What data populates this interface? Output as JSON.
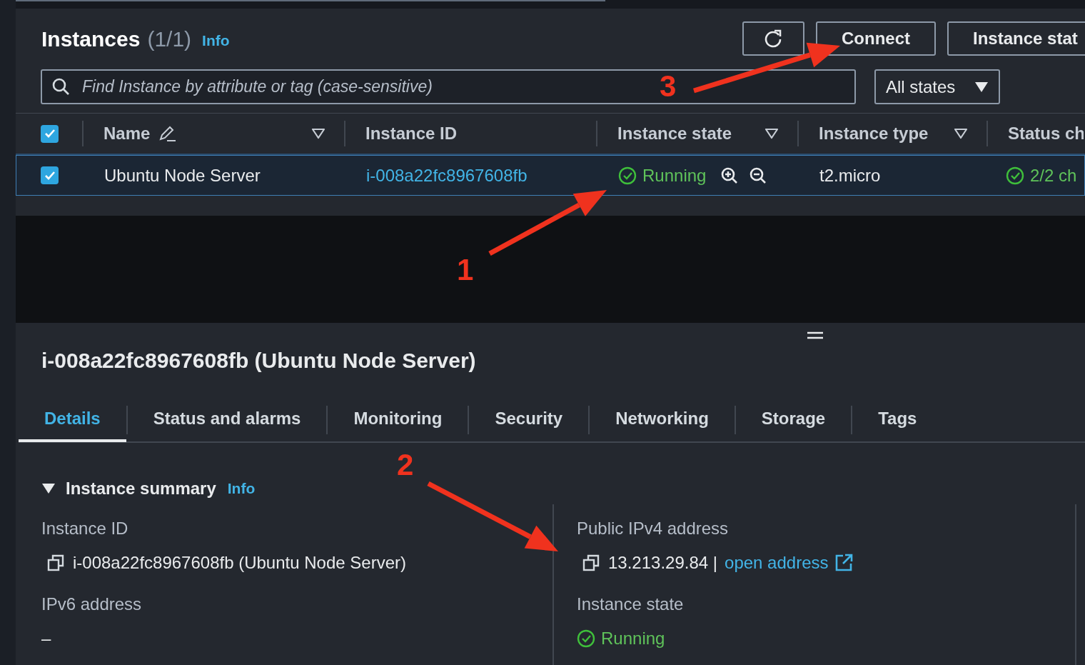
{
  "instances_panel": {
    "title": "Instances",
    "count": "(1/1)",
    "info": "Info",
    "buttons": [
      {
        "kind": "refresh"
      },
      {
        "kind": "text",
        "label": "Connect"
      },
      {
        "kind": "text",
        "label": "Instance stat"
      }
    ],
    "search": {
      "placeholder": "Find Instance by attribute or tag (case-sensitive)"
    },
    "state_filter": {
      "value": "All states"
    }
  },
  "table": {
    "select_all_checked": true,
    "columns": [
      {
        "label": "Name",
        "kind": "edit"
      },
      {
        "label": "Instance ID",
        "kind": "plain"
      },
      {
        "label": "Instance state",
        "kind": "filter"
      },
      {
        "label": "Instance type",
        "kind": "filter"
      },
      {
        "label": "Status ch",
        "kind": "plain"
      }
    ],
    "rows": [
      {
        "selected": true,
        "checked": true,
        "name": "Ubuntu Node Server",
        "instance_id": "i-008a22fc8967608fb",
        "state": "Running",
        "type": "t2.micro",
        "status_check": "2/2 ch"
      }
    ]
  },
  "details": {
    "title": "i-008a22fc8967608fb (Ubuntu Node Server)",
    "tabs": [
      {
        "label": "Details",
        "selected": true
      },
      {
        "label": "Status and alarms",
        "selected": false
      },
      {
        "label": "Monitoring",
        "selected": false
      },
      {
        "label": "Security",
        "selected": false
      },
      {
        "label": "Networking",
        "selected": false
      },
      {
        "label": "Storage",
        "selected": false
      },
      {
        "label": "Tags",
        "selected": false
      }
    ],
    "section": {
      "title": "Instance summary",
      "info": "Info",
      "expanded": true
    },
    "fields": [
      {
        "kind": "copy",
        "label": "Instance ID",
        "value": "i-008a22fc8967608fb (Ubuntu Node Server)"
      },
      {
        "kind": "copy_link",
        "label": "Public IPv4 address",
        "value": "13.213.29.84 |",
        "link": "open address"
      },
      {
        "kind": "plain",
        "label": "IPv6 address",
        "value": "–"
      },
      {
        "kind": "status",
        "label": "Instance state",
        "value": "Running"
      }
    ]
  },
  "annotations": [
    {
      "label": "1"
    },
    {
      "label": "2"
    },
    {
      "label": "3"
    }
  ]
}
